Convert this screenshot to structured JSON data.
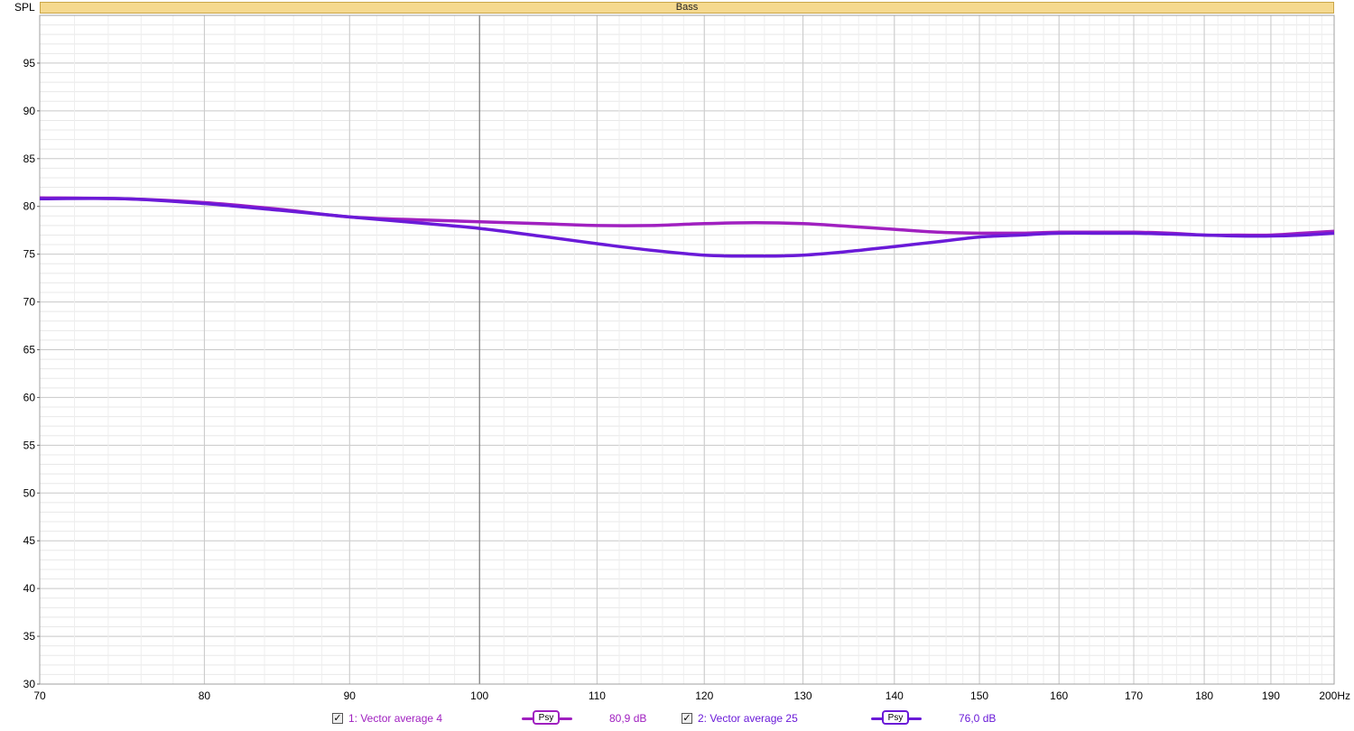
{
  "chart_data": {
    "type": "line",
    "title": "Bass",
    "ylabel": "SPL",
    "x_unit": "Hz",
    "xscale": "log",
    "xlim": [
      70,
      200
    ],
    "ylim": [
      30,
      100
    ],
    "x_ticks": [
      70,
      80,
      90,
      100,
      110,
      120,
      130,
      140,
      150,
      160,
      170,
      180,
      190,
      200
    ],
    "x_tick_labels": [
      "70",
      "80",
      "90",
      "100",
      "110",
      "120",
      "130",
      "140",
      "150",
      "160",
      "170",
      "180",
      "190",
      "200Hz"
    ],
    "y_ticks": [
      30,
      35,
      40,
      45,
      50,
      55,
      60,
      65,
      70,
      75,
      80,
      85,
      90,
      95
    ],
    "y_tick_labels": [
      "30",
      "35",
      "40",
      "45",
      "50",
      "55",
      "60",
      "65",
      "70",
      "75",
      "80",
      "85",
      "90",
      "95"
    ],
    "grid": true,
    "series": [
      {
        "name": "1: Vector average 4",
        "color": "#a020c0",
        "x": [
          70,
          75,
          80,
          85,
          90,
          95,
          100,
          105,
          110,
          115,
          120,
          125,
          130,
          135,
          140,
          145,
          150,
          155,
          160,
          165,
          170,
          175,
          180,
          185,
          190,
          195,
          200
        ],
        "values": [
          80.9,
          80.8,
          80.4,
          79.7,
          78.9,
          78.6,
          78.4,
          78.2,
          78.0,
          78.0,
          78.2,
          78.3,
          78.2,
          77.9,
          77.6,
          77.3,
          77.2,
          77.2,
          77.3,
          77.3,
          77.3,
          77.2,
          77.0,
          77.0,
          77.0,
          77.2,
          77.4
        ]
      },
      {
        "name": "2: Vector average 25",
        "color": "#6a1ad8",
        "x": [
          70,
          75,
          80,
          85,
          90,
          95,
          100,
          105,
          110,
          115,
          120,
          125,
          130,
          135,
          140,
          145,
          150,
          155,
          160,
          165,
          170,
          175,
          180,
          185,
          190,
          195,
          200
        ],
        "values": [
          80.8,
          80.8,
          80.3,
          79.6,
          78.9,
          78.3,
          77.7,
          76.9,
          76.1,
          75.4,
          74.9,
          74.8,
          74.9,
          75.3,
          75.8,
          76.3,
          76.8,
          77.0,
          77.2,
          77.2,
          77.2,
          77.1,
          77.0,
          76.9,
          76.9,
          77.0,
          77.2
        ]
      }
    ]
  },
  "legend": [
    {
      "checked": "✓",
      "label": "1: Vector average 4",
      "psy": "Psy",
      "value": "80,9 dB",
      "color": "#a020c0"
    },
    {
      "checked": "✓",
      "label": "2: Vector average 25",
      "psy": "Psy",
      "value": "76,0 dB",
      "color": "#6a1ad8"
    }
  ]
}
